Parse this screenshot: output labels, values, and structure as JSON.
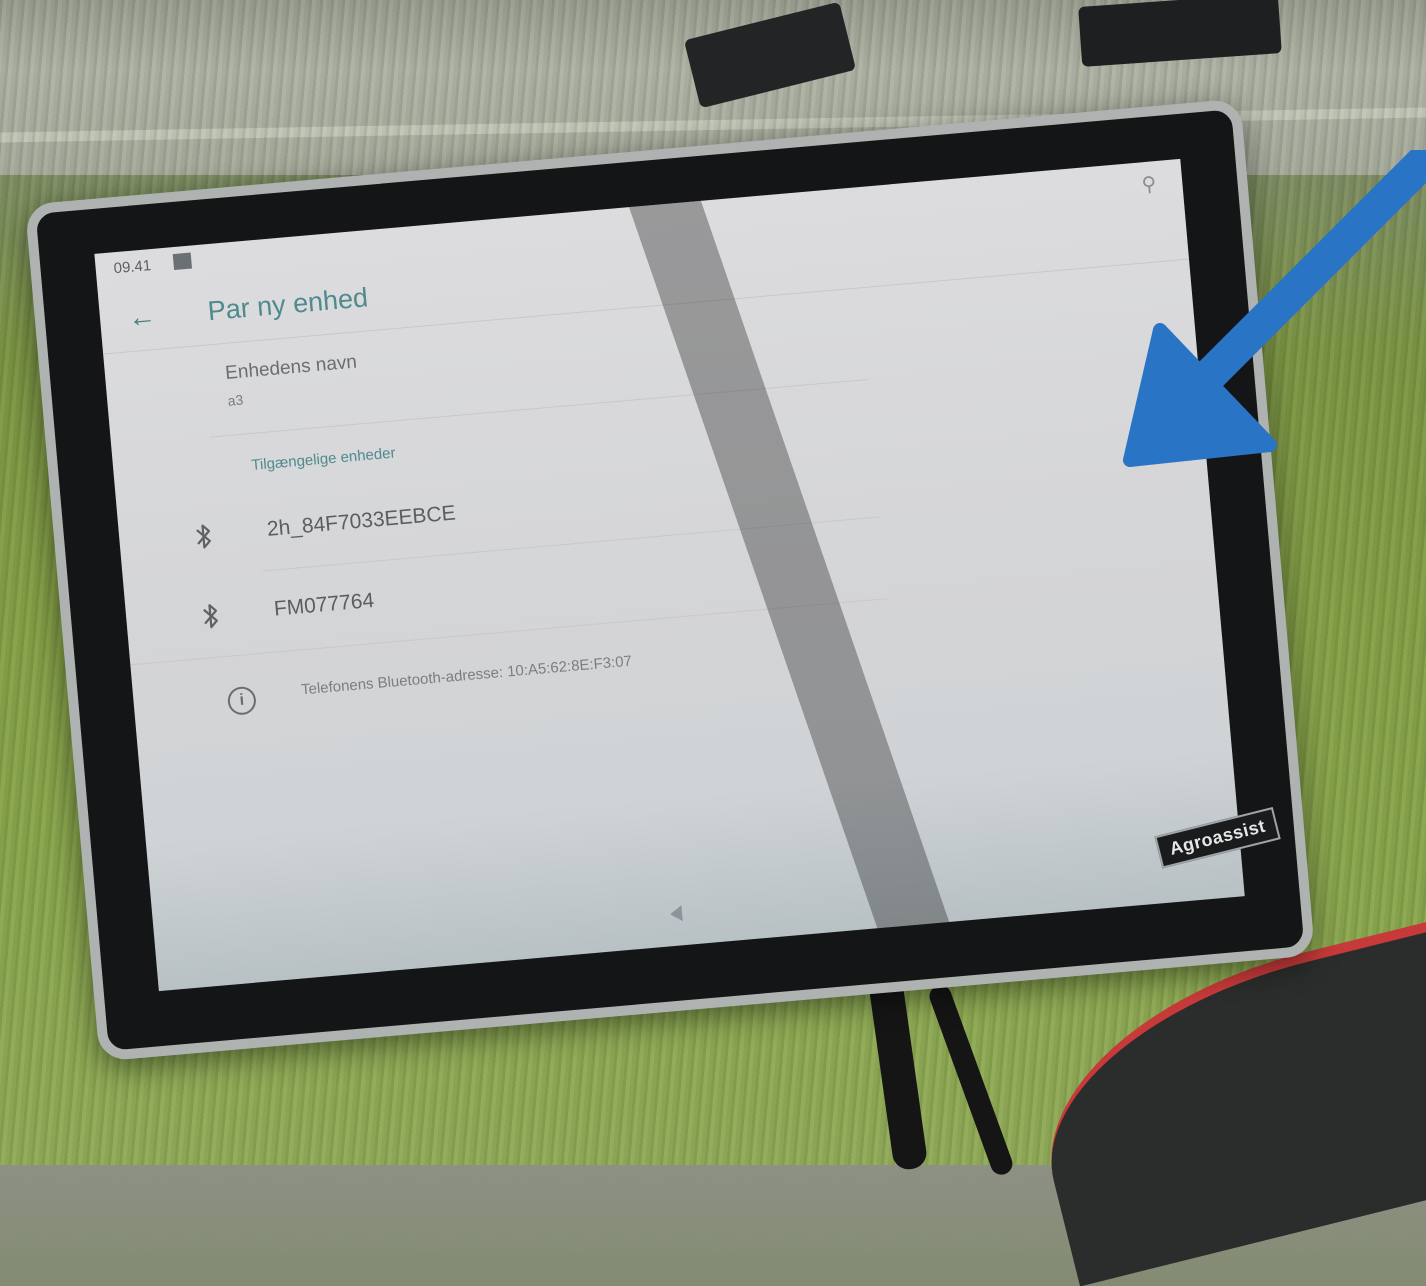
{
  "status_bar": {
    "time": "09.41"
  },
  "app_bar": {
    "title": "Par ny enhed"
  },
  "device_name_field": {
    "label": "Enhedens navn",
    "value": "a3"
  },
  "available_devices": {
    "header": "Tilgængelige enheder",
    "items": [
      {
        "name": "2h_84F7033EEBCE",
        "icon": "bluetooth-icon"
      },
      {
        "name": "FM077764",
        "icon": "bluetooth-icon"
      }
    ]
  },
  "info": {
    "icon": "info-icon",
    "text": "Telefonens Bluetooth-adresse: 10:A5:62:8E:F3:07"
  },
  "bezel": {
    "brand": "Agroassist"
  },
  "colors": {
    "accent": "#4f8a8e",
    "overlay_arrow": "#2a74c6"
  }
}
